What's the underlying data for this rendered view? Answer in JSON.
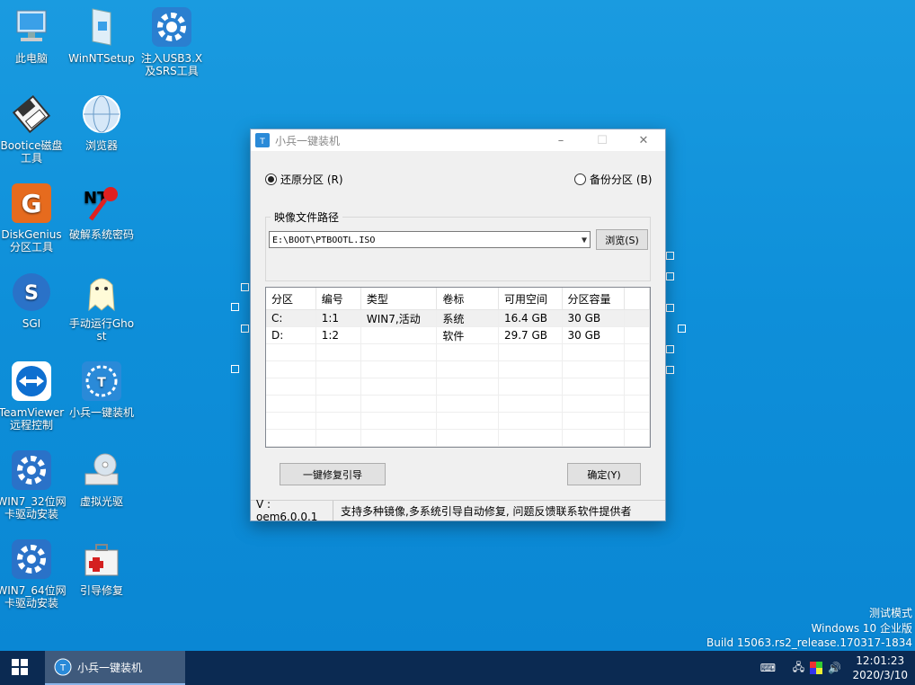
{
  "desktop": {
    "icons": [
      {
        "label": "此电脑",
        "icon": "computer-icon"
      },
      {
        "label": "WinNTSetup",
        "icon": "document-icon"
      },
      {
        "label": "注入USB3.X及SRS工具",
        "icon": "gear-icon"
      },
      {
        "label": "Bootice磁盘工具",
        "icon": "disk-icon"
      },
      {
        "label": "浏览器",
        "icon": "globe-icon"
      },
      {
        "label": "DiskGenius分区工具",
        "icon": "diskgenius-icon"
      },
      {
        "label": "破解系统密码",
        "icon": "key-icon"
      },
      {
        "label": "SGI",
        "icon": "sgi-icon"
      },
      {
        "label": "手动运行Ghost",
        "icon": "ghost-icon"
      },
      {
        "label": "TeamViewer远程控制",
        "icon": "teamviewer-icon"
      },
      {
        "label": "小兵一键装机",
        "icon": "installer-icon"
      },
      {
        "label": "WIN7_32位网卡驱动安装",
        "icon": "driver-icon"
      },
      {
        "label": "虚拟光驱",
        "icon": "cd-drive-icon"
      },
      {
        "label": "WIN7_64位网卡驱动安装",
        "icon": "driver-icon"
      },
      {
        "label": "引导修复",
        "icon": "first-aid-icon"
      }
    ]
  },
  "dialog": {
    "title": "小兵一键装机",
    "restore_label": "还原分区 (R)",
    "backup_label": "备份分区 (B)",
    "selected_mode": "restore",
    "path_group_title": "映像文件路径",
    "path_value": "E:\\BOOT\\PTBOOTL.ISO",
    "browse_label": "浏览(S)",
    "table": {
      "columns": [
        "分区",
        "编号",
        "类型",
        "卷标",
        "可用空间",
        "分区容量"
      ],
      "rows": [
        [
          "C:",
          "1:1",
          "WIN7,活动",
          "系统",
          "16.4 GB",
          "30 GB"
        ],
        [
          "D:",
          "1:2",
          "",
          "软件",
          "29.7 GB",
          "30 GB"
        ]
      ]
    },
    "repair_label": "一键修复引导",
    "confirm_label": "确定(Y)",
    "version": "V : oem6.0.0.1",
    "status_message": "支持多种镜像,多系统引导自动修复, 问题反馈联系软件提供者"
  },
  "watermark": {
    "line1": "测试模式",
    "line2": "Windows 10 企业版",
    "line3": "Build 15063.rs2_release.170317-1834"
  },
  "taskbar": {
    "app_label": "小兵一键装机",
    "time": "12:01:23",
    "date": "2020/3/10"
  },
  "colors": {
    "desktop_bg": "#0e8fd9",
    "taskbar_bg": "#0b2a52"
  }
}
